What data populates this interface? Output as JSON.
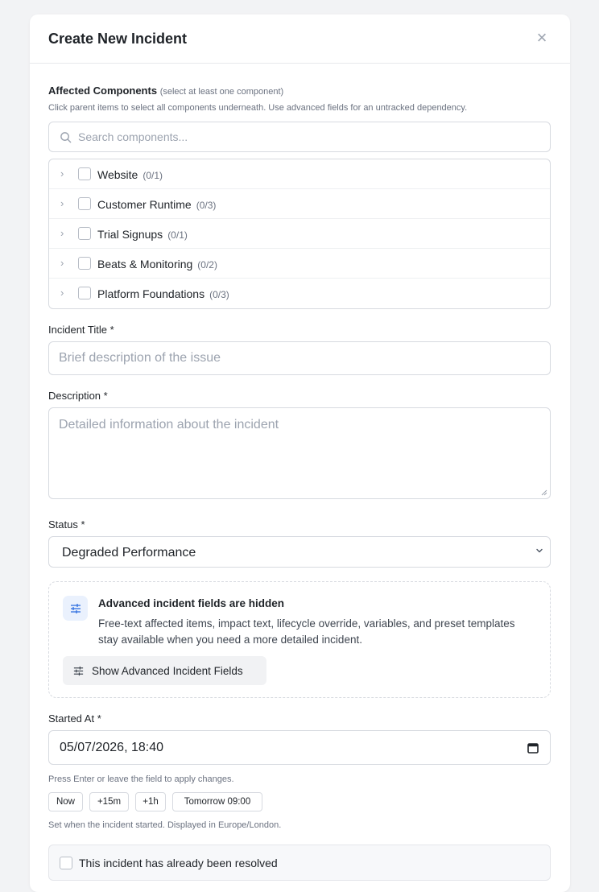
{
  "modal": {
    "title": "Create New Incident",
    "close_symbol": "×"
  },
  "components": {
    "label": "Affected Components",
    "label_hint": "(select at least one component)",
    "help": "Click parent items to select all components underneath. Use advanced fields for an untracked dependency.",
    "search_placeholder": "Search components...",
    "items": [
      {
        "label": "Website",
        "count": "(0/1)"
      },
      {
        "label": "Customer Runtime",
        "count": "(0/3)"
      },
      {
        "label": "Trial Signups",
        "count": "(0/1)"
      },
      {
        "label": "Beats & Monitoring",
        "count": "(0/2)"
      },
      {
        "label": "Platform Foundations",
        "count": "(0/3)"
      }
    ]
  },
  "title_field": {
    "label": "Incident Title *",
    "placeholder": "Brief description of the issue"
  },
  "description_field": {
    "label": "Description *",
    "placeholder": "Detailed information about the incident"
  },
  "status_field": {
    "label": "Status *",
    "value": "Degraded Performance"
  },
  "advanced": {
    "title": "Advanced incident fields are hidden",
    "description": "Free-text affected items, impact text, lifecycle override, variables, and preset templates stay available when you need a more detailed incident.",
    "button_label": "Show Advanced Incident Fields",
    "icon": "sliders-icon",
    "icon_bg": "#eaf1fd",
    "icon_color": "#2f6fe0"
  },
  "started_at": {
    "label": "Started At *",
    "value": "05/07/2026, 18:40",
    "apply_hint": "Press Enter or leave the field to apply changes.",
    "presets": [
      "Now",
      "+15m",
      "+1h",
      "Tomorrow 09:00"
    ],
    "timezone_hint": "Set when the incident started. Displayed in Europe/London."
  },
  "resolved": {
    "label": "This incident has already been resolved"
  }
}
